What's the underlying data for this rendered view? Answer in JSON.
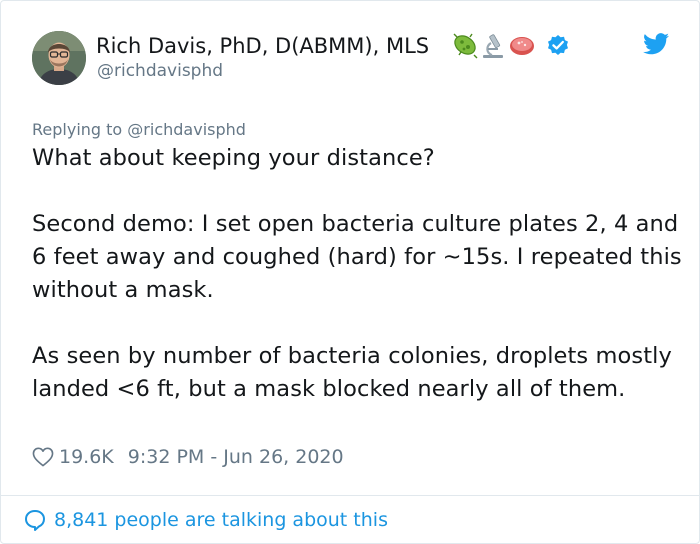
{
  "tweet": {
    "author_name": "Rich Davis, PhD, D(ABMM), MLS",
    "author_handle": "@richdavisphd",
    "name_emojis": [
      "microbe",
      "microscope",
      "petri-dish"
    ],
    "reply_prefix": "Replying to ",
    "reply_handle": "@richdavisphd",
    "paragraphs": [
      "What about keeping your distance?",
      "Second demo: I set open bacteria culture plates 2, 4 and 6 feet away and coughed (hard) for ~15s. I repeated this without a mask.",
      "As seen by number of bacteria colonies, droplets mostly landed <6 ft, but a mask blocked nearly all of them."
    ],
    "likes": "19.6K",
    "timestamp": "9:32 PM - Jun 26, 2020",
    "talking_text": "8,841 people are talking about this"
  },
  "icons": {
    "like": "heart-icon",
    "reply_bubble": "speech-bubble-icon",
    "verified": "verified-badge-icon",
    "brand": "twitter-bird-icon"
  },
  "colors": {
    "text": "#14171a",
    "secondary": "#657786",
    "link": "#1b95e0",
    "twitter_blue": "#1da1f2",
    "border": "#e1e8ed"
  }
}
